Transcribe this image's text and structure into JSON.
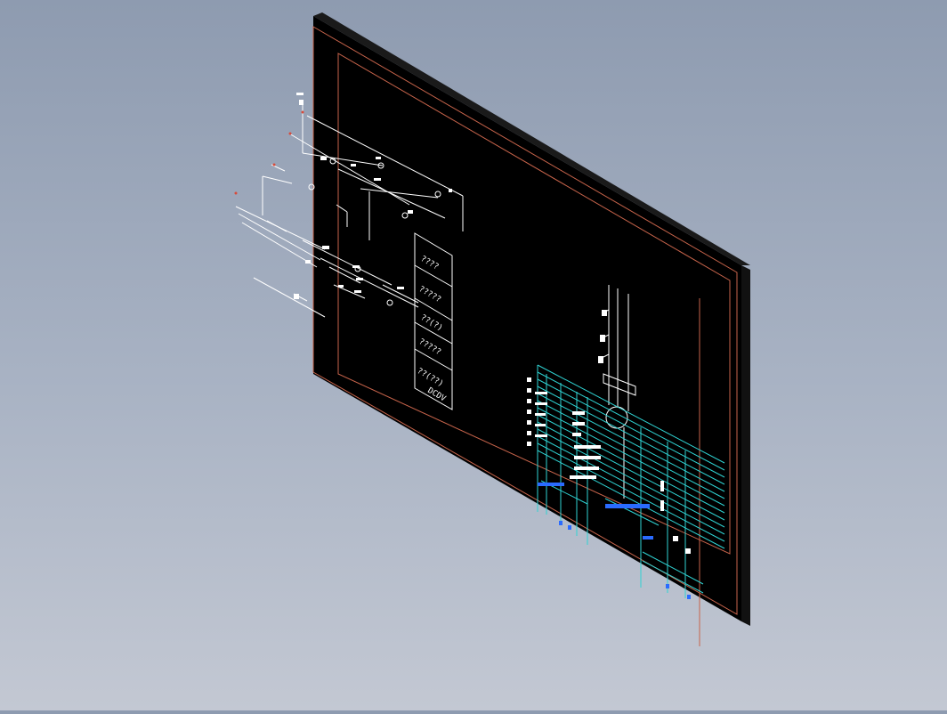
{
  "colors": {
    "background_top": "#8e9bb0",
    "background_bottom": "#c3c8d3",
    "sheet": "#000000",
    "sheet_edge": "#111111",
    "frame": "#c8644b",
    "wire": "#ffffff",
    "table": "#2fd3d3",
    "text_blue": "#2a6bff"
  },
  "drawing": {
    "legend_cells": [
      "????",
      "?????",
      "??(?)",
      "?????",
      "??(??)"
    ],
    "legend_bottom_label": "DCDV"
  }
}
